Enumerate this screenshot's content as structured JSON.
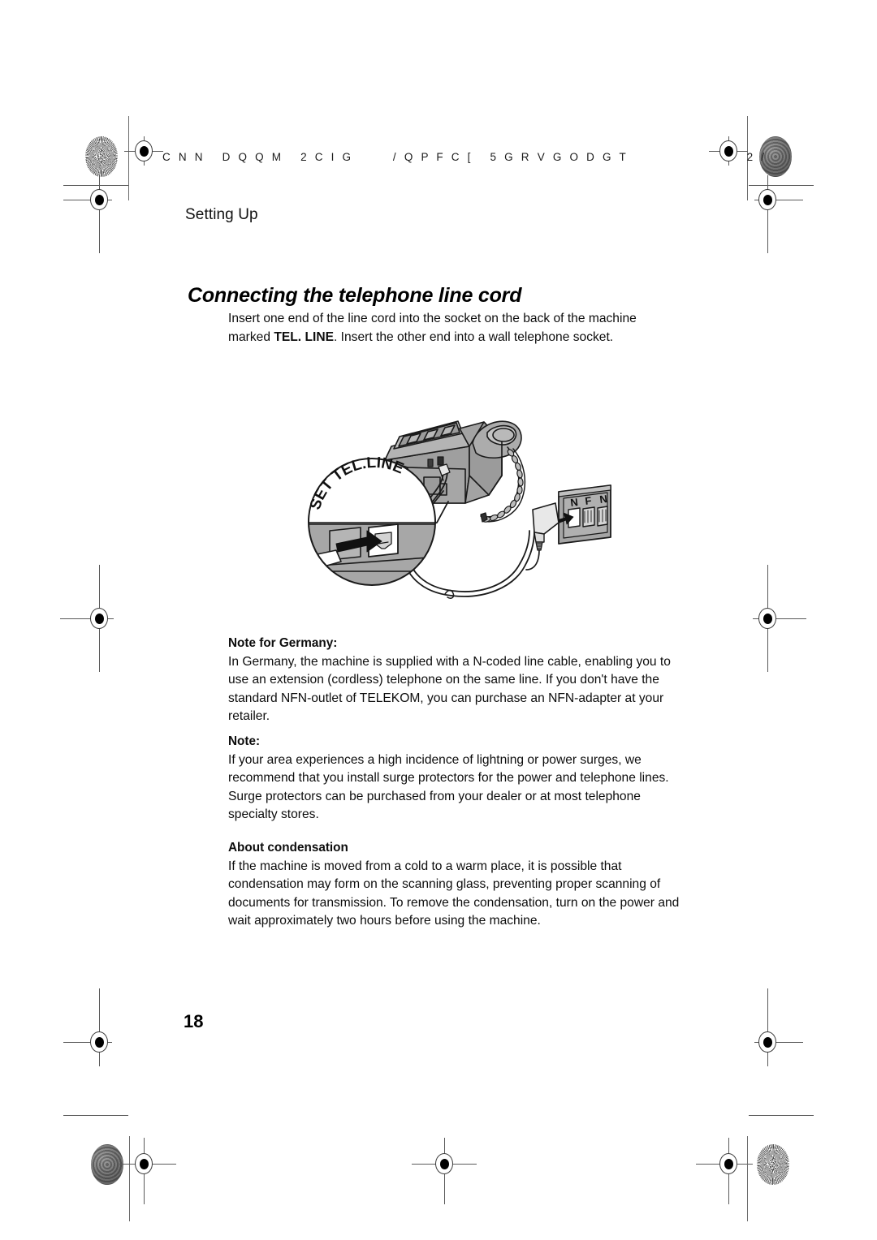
{
  "page": {
    "header_code": "C N N   D Q Q M   2 C I G       / Q P F C [   5 G R V G O D G T                     2 /",
    "running_head": "Setting Up",
    "section_title": "Connecting the telephone line cord",
    "page_number": "18"
  },
  "intro": {
    "text_before": "Insert one end of the line cord into the socket on the back of the machine marked ",
    "bold_term": "TEL. LINE",
    "text_after": ". Insert the other end into a wall telephone socket."
  },
  "notes": [
    {
      "heading": "Note for Germany:",
      "body": "In Germany, the machine is supplied with a N-coded line cable, enabling you to use an extension (cordless) telephone on the same line. If you don't have the standard NFN-outlet of TELEKOM, you can purchase an NFN-adapter at your retailer."
    },
    {
      "heading": "Note:",
      "body": "If your area experiences a high incidence of lightning or power surges, we recommend that you install surge protectors for the power and telephone lines. Surge protectors can be purchased from your dealer or at most telephone specialty stores."
    },
    {
      "heading": "About condensation",
      "body": "If the machine is moved from a cold to a warm place, it is possible that condensation may form on the scanning glass, preventing proper scanning of documents for transmission. To remove the condensation, turn on the power and wait approximately two hours before using the machine."
    }
  ],
  "illustration": {
    "callout_label": "SET TEL.LINE",
    "wall_socket_label": "N F N",
    "socket_letters": [
      "N",
      "F",
      "N"
    ],
    "colors": {
      "machine_body": "#a3a3a3",
      "machine_shade": "#8d8d8d",
      "machine_light": "#c2c2c2",
      "outline": "#1a1a1a",
      "white": "#ffffff"
    }
  }
}
